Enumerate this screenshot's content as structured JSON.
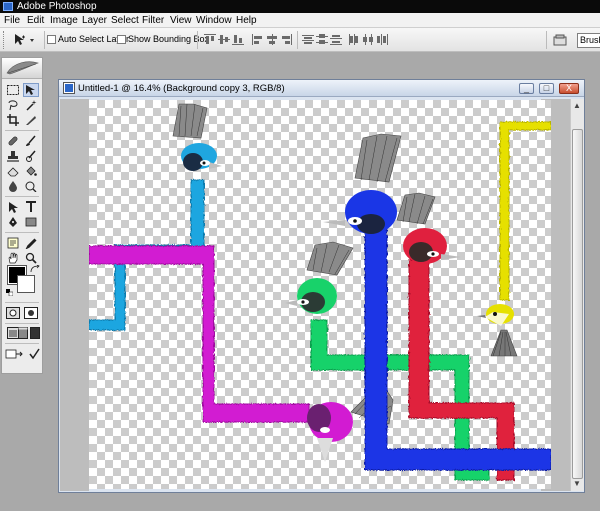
{
  "app": {
    "title": "Adobe Photoshop"
  },
  "menu": {
    "items": [
      "File",
      "Edit",
      "Image",
      "Layer",
      "Select",
      "Filter",
      "View",
      "Window",
      "Help"
    ]
  },
  "options_bar": {
    "auto_select_layer_label": "Auto Select Layer",
    "auto_select_layer_checked": false,
    "show_bounding_box_label": "Show Bounding Box",
    "show_bounding_box_checked": false,
    "brush_label": "Brush"
  },
  "toolbox": {
    "active_tool": "move-tool",
    "foreground_color": "#000000",
    "background_color": "#ffffff"
  },
  "document": {
    "title": "Untitled-1 @ 16.4% (Background copy 3, RGB/8)",
    "minimize_symbol": "_",
    "maximize_symbol": "□",
    "close_symbol": "X"
  },
  "colors": {
    "peacock_cyan": "#1fa6e0",
    "peacock_magenta": "#d21bd2",
    "peacock_blue": "#1a36e6",
    "peacock_green": "#18d26a",
    "peacock_red": "#e0203e",
    "peacock_yellow": "#e6e000"
  }
}
